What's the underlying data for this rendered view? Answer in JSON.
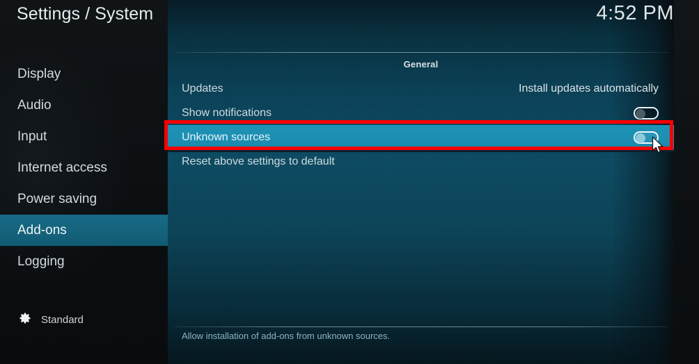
{
  "header": {
    "title": "Settings / System",
    "clock": "4:52 PM"
  },
  "sidebar": {
    "items": [
      {
        "label": "Display",
        "selected": false
      },
      {
        "label": "Audio",
        "selected": false
      },
      {
        "label": "Input",
        "selected": false
      },
      {
        "label": "Internet access",
        "selected": false
      },
      {
        "label": "Power saving",
        "selected": false
      },
      {
        "label": "Add-ons",
        "selected": true
      },
      {
        "label": "Logging",
        "selected": false
      }
    ],
    "profile": {
      "icon": "gear-icon",
      "label": "Standard"
    }
  },
  "main": {
    "group_title": "General",
    "rows": [
      {
        "label": "Updates",
        "control": "text",
        "value": "Install updates automatically",
        "highlighted": false
      },
      {
        "label": "Show notifications",
        "control": "toggle",
        "value": "off",
        "highlighted": false
      },
      {
        "label": "Unknown sources",
        "control": "toggle",
        "value": "off",
        "highlighted": true
      },
      {
        "label": "Reset above settings to default",
        "control": "none",
        "value": "",
        "highlighted": false
      }
    ],
    "help_text": "Allow installation of add-ons from unknown sources."
  },
  "annotation": {
    "color": "#fe0000",
    "target": "Unknown sources"
  },
  "colors": {
    "accent": "#1e93b6",
    "sidebar_selected": "#176b86",
    "panel_bg": "#0c4a61",
    "annotation_red": "#fe0000"
  }
}
